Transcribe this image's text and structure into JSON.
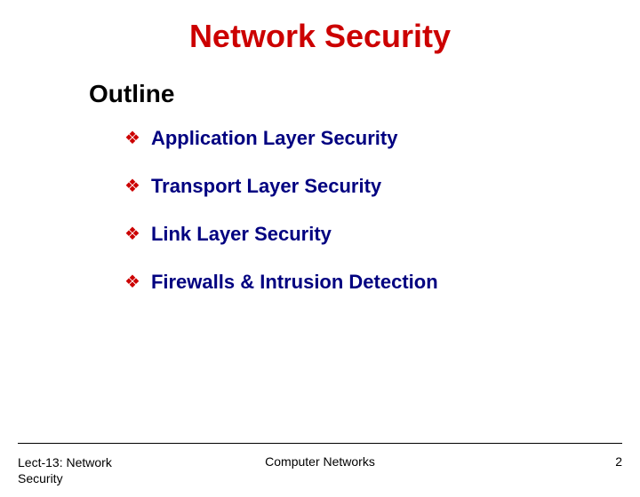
{
  "title": "Network Security",
  "section": "Outline",
  "bullets": [
    "Application Layer Security",
    "Transport Layer Security",
    "Link Layer Security",
    "Firewalls & Intrusion Detection"
  ],
  "footer": {
    "left_line1": "Lect-13: Network",
    "left_line2": "Security",
    "center": "Computer Networks",
    "page": "2"
  },
  "colors": {
    "title_color": "#cc0000",
    "bullet_color": "#cc0000",
    "text_color": "#000080"
  },
  "bullet_glyph": "❖"
}
